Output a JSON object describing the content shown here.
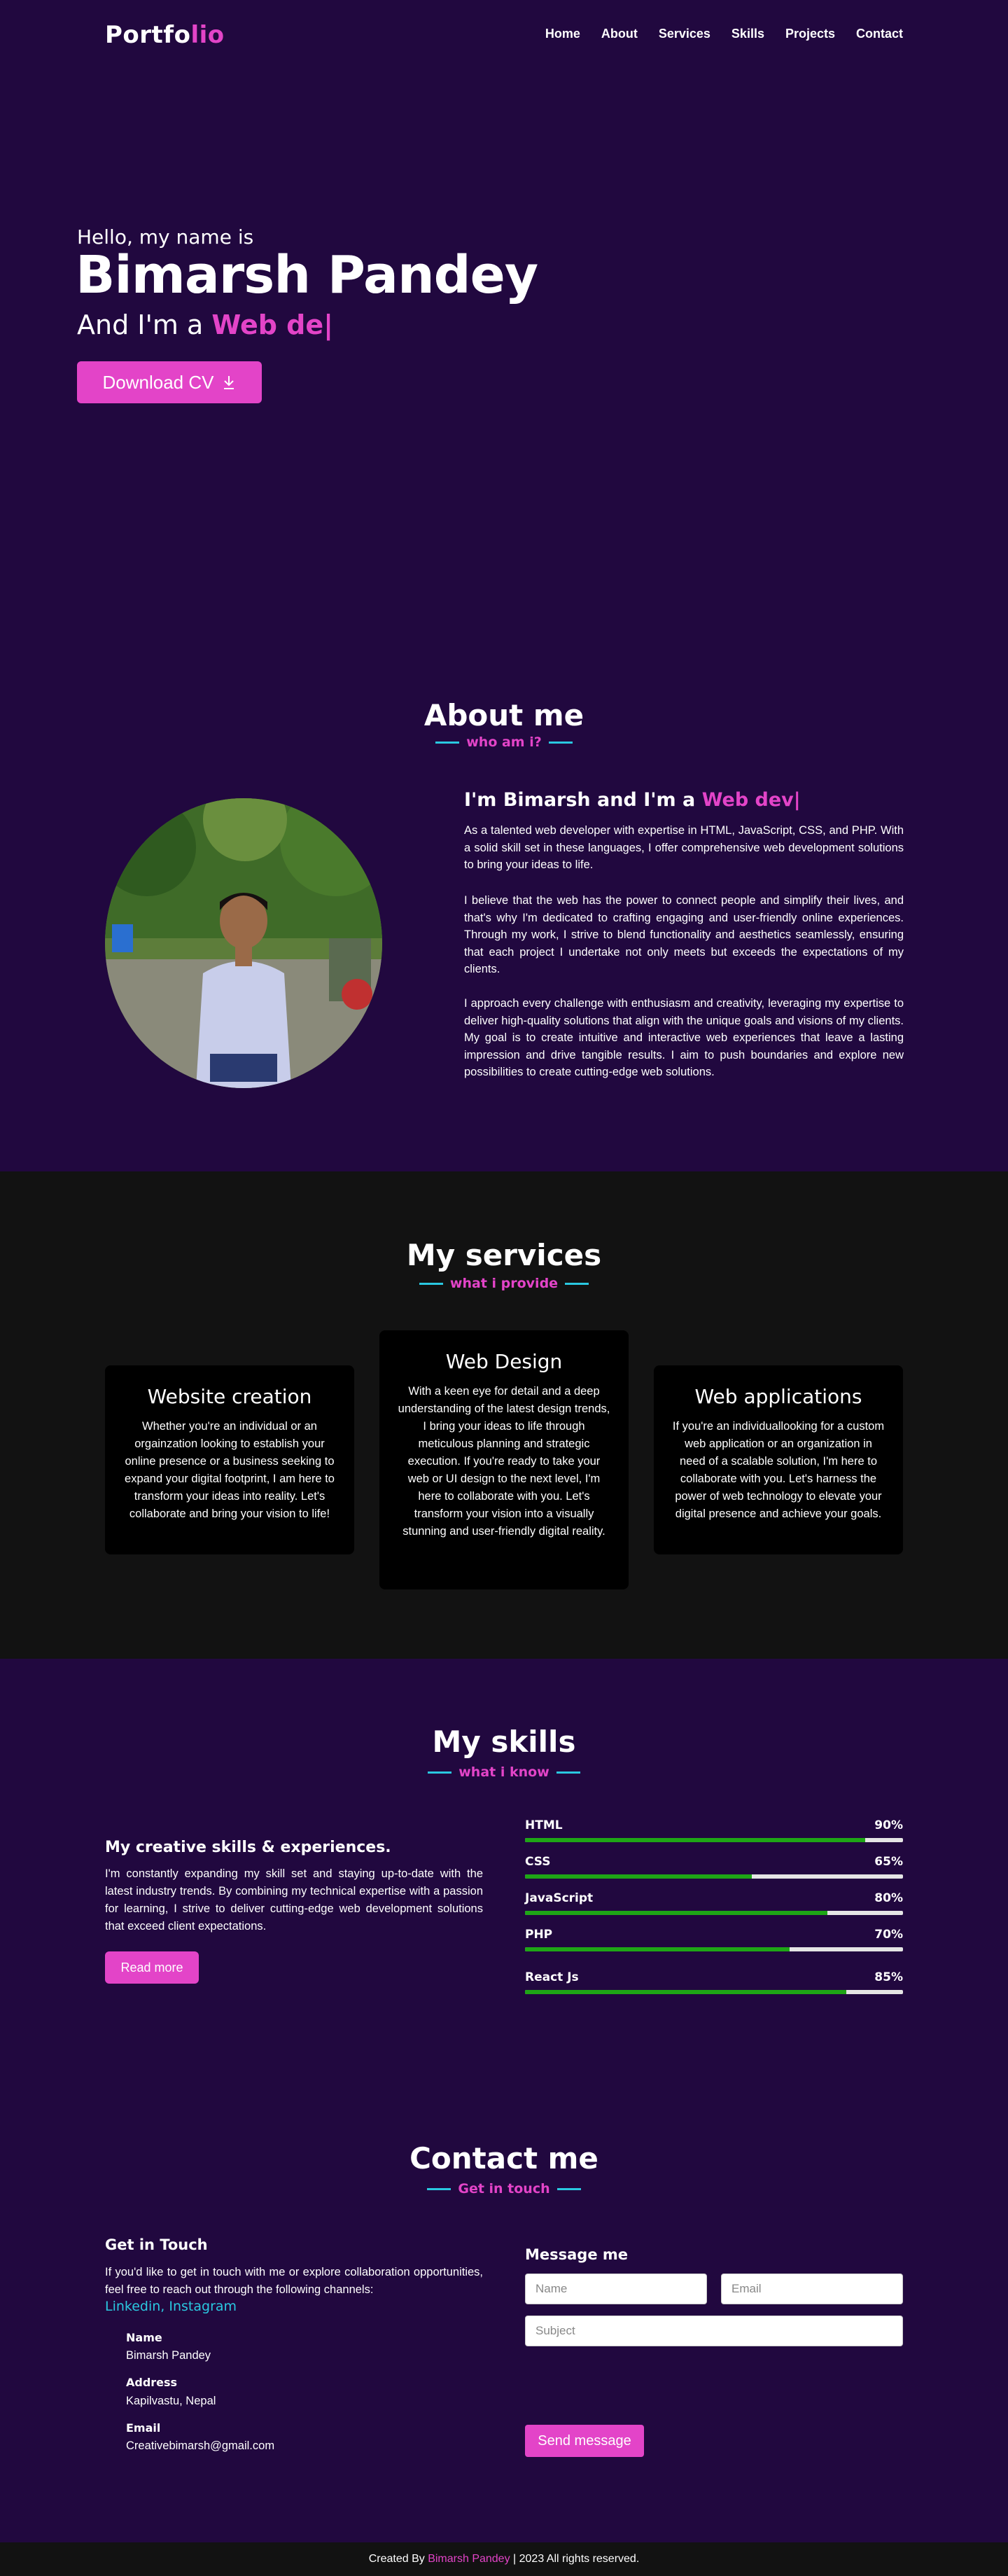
{
  "nav": {
    "logo_main": "Portfo",
    "logo_accent": "lio",
    "links": [
      "Home",
      "About",
      "Services",
      "Skills",
      "Projects",
      "Contact"
    ]
  },
  "hero": {
    "greeting": "Hello, my name is",
    "name": "Bimarsh Pandey",
    "role_prefix": "And I'm a ",
    "role_typed": "Web de|",
    "cta": "Download CV"
  },
  "about": {
    "title": "About me",
    "subtitle": "who am i?",
    "heading_prefix": "I'm Bimarsh and I'm a ",
    "heading_typed": "Web dev|",
    "paragraphs": [
      "As a talented web developer with expertise in HTML, JavaScript, CSS, and PHP. With a solid skill set in these languages, I offer comprehensive web development solutions to bring your ideas to life.",
      "I believe that the web has the power to connect people and simplify their lives, and that's why I'm dedicated to crafting engaging and user-friendly online experiences. Through my work, I strive to blend functionality and aesthetics seamlessly, ensuring that each project I undertake not only meets but exceeds the expectations of my clients.",
      "I approach every challenge with enthusiasm and creativity, leveraging my expertise to deliver high-quality solutions that align with the unique goals and visions of my clients. My goal is to create intuitive and interactive web experiences that leave a lasting impression and drive tangible results. I aim to push boundaries and explore new possibilities to create cutting-edge web solutions."
    ]
  },
  "services": {
    "title": "My services",
    "subtitle": "what i provide",
    "cards": [
      {
        "title": "Website creation",
        "text": "Whether you're an individual or an orgainzation looking to establish your online presence or a business seeking to expand your digital footprint, I am here to transform your ideas into reality. Let's collaborate and bring your vision to life!"
      },
      {
        "title": "Web Design",
        "text": "With a keen eye for detail and a deep understanding of the latest design trends, I bring your ideas to life through meticulous planning and strategic execution. If you're ready to take your web or UI design to the next level, I'm here to collaborate with you. Let's transform your vision into a visually stunning and user-friendly digital reality."
      },
      {
        "title": "Web applications",
        "text": "If you're an individuallooking for a custom web application or an organization in need of a scalable solution, I'm here to collaborate with you. Let's harness the power of web technology to elevate your digital presence and achieve your goals."
      }
    ]
  },
  "skills": {
    "title": "My skills",
    "subtitle": "what i know",
    "heading": "My creative skills & experiences.",
    "text": "I'm constantly expanding my skill set and staying up-to-date with the latest industry trends. By combining my technical expertise with a passion for learning, I strive to deliver cutting-edge web development solutions that exceed client expectations.",
    "button": "Read more",
    "items": [
      {
        "name": "HTML",
        "label": "90%",
        "value": 0.9
      },
      {
        "name": "CSS",
        "label": "65%",
        "value": 0.6
      },
      {
        "name": "JavaScript",
        "label": "80%",
        "value": 0.8
      },
      {
        "name": "PHP",
        "label": "70%",
        "value": 0.7
      },
      {
        "name": "React Js",
        "label": "85%",
        "value": 0.85
      }
    ]
  },
  "contact": {
    "title": "Contact me",
    "subtitle": "Get in touch",
    "left_heading": "Get in Touch",
    "left_text": "If you'd like to get in touch with me or explore collaboration opportunities, feel free to reach out through the following channels:",
    "links": "Linkedin, Instagram",
    "name_label": "Name",
    "name_value": "Bimarsh Pandey",
    "address_label": "Address",
    "address_value": "Kapilvastu, Nepal",
    "email_label": "Email",
    "email_value": "Creativebimarsh@gmail.com",
    "form_heading": "Message me",
    "name_placeholder": "Name",
    "email_placeholder": "Email",
    "subject_placeholder": "Subject",
    "send": "Send message"
  },
  "footer": {
    "prefix": "Created By ",
    "author": "Bimarsh Pandey",
    "suffix": " | 2023 All rights reserved."
  },
  "colors": {
    "background": "#21083f",
    "accent": "#e344c8",
    "line_accent": "#2ac8e0",
    "dark_section": "#121212",
    "progress": "#1ea616"
  }
}
